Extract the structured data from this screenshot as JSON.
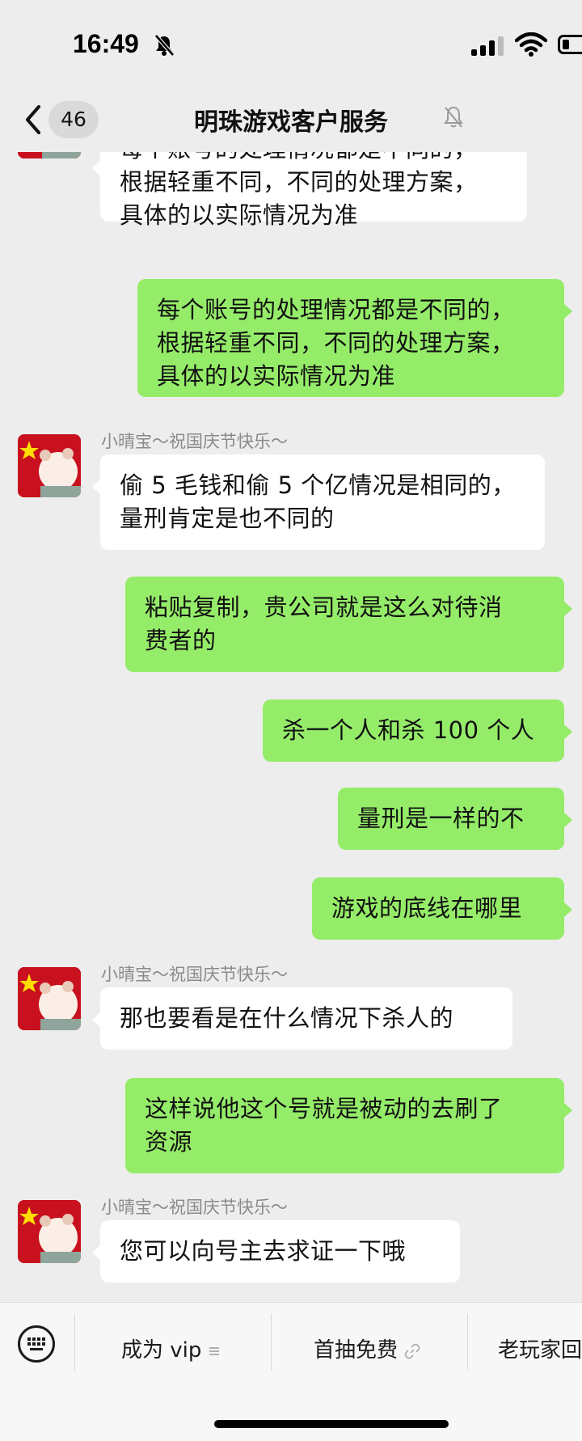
{
  "status_bar": {
    "time": "16:49"
  },
  "header": {
    "unread_count": "46",
    "title": "明珠游戏客户服务"
  },
  "messages": [
    {
      "side": "in",
      "text": "每个账号的处理情况都是不同的，\n根据轻重不同，不同的处理方案，\n具体的以实际情况为准"
    },
    {
      "side": "out",
      "text": "每个账号的处理情况都是不同的，\n根据轻重不同，不同的处理方案，\n具体的以实际情况为准"
    },
    {
      "side": "in",
      "sender": "小晴宝～祝国庆节快乐～",
      "text": "偷 5 毛钱和偷 5 个亿情况是相同的，\n量刑肯定是也不同的"
    },
    {
      "side": "out",
      "text": "粘贴复制，贵公司就是这么对待消\n费者的"
    },
    {
      "side": "out",
      "text": "杀一个人和杀 100 个人"
    },
    {
      "side": "out",
      "text": "量刑是一样的不"
    },
    {
      "side": "out",
      "text": "游戏的底线在哪里"
    },
    {
      "side": "in",
      "sender": "小晴宝～祝国庆节快乐～",
      "text": "那也要看是在什么情况下杀人的"
    },
    {
      "side": "out",
      "text": "这样说他这个号就是被动的去刷了\n资源"
    },
    {
      "side": "in",
      "sender": "小晴宝～祝国庆节快乐～",
      "text": "您可以向号主去求证一下哦"
    }
  ],
  "bottom_menu": {
    "items": [
      {
        "label": "成为 vip",
        "icon": "menu-list-icon"
      },
      {
        "label": "首抽免费",
        "icon": "link-icon"
      },
      {
        "label": "老玩家回"
      }
    ]
  },
  "colors": {
    "background": "#ededed",
    "incoming_bubble": "#ffffff",
    "outgoing_bubble": "#95ec69",
    "sender_name": "#8a8a8a"
  }
}
